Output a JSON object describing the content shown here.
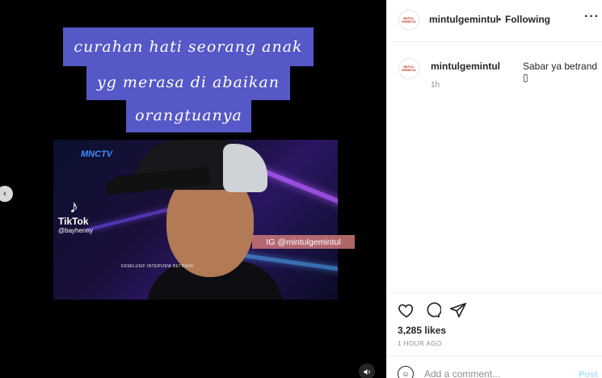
{
  "media": {
    "caption_lines": [
      "curahan hati seorang anak",
      "yg merasa di abaikan",
      "orangtuanya"
    ],
    "video": {
      "channel_logo": "MNCTV",
      "tiktok_brand": "TikTok",
      "tiktok_handle": "@bayhenny",
      "subtitle": "EKSKLUSIF INTERVIEW BETRAND"
    },
    "ig_tag": "IG @mintulgemintul",
    "nav_prev_icon": "chevron-left-icon",
    "sound_icon": "speaker-icon"
  },
  "header": {
    "avatar_text": "MINTUL GEMINTUL",
    "username": "mintulgemintul",
    "separator": "•",
    "follow_label": "Following",
    "more_icon": "ellipsis-icon"
  },
  "comment": {
    "avatar_text": "MINTUL GEMINTUL",
    "username": "mintulgemintul",
    "text": "Sabar ya betrand ▯",
    "time": "1h"
  },
  "actions": {
    "icons": [
      "heart-icon",
      "comment-icon",
      "share-icon"
    ],
    "likes": "3,285 likes",
    "posted_ago": "1 HOUR AGO"
  },
  "add_comment": {
    "placeholder": "Add a comment...",
    "post_label": "Post"
  },
  "colors": {
    "caption_bg": "#5558c6",
    "ig_tag_bg": "#ce7878",
    "post_button": "#b2dffc",
    "secondary_text": "#8e8e8e"
  }
}
